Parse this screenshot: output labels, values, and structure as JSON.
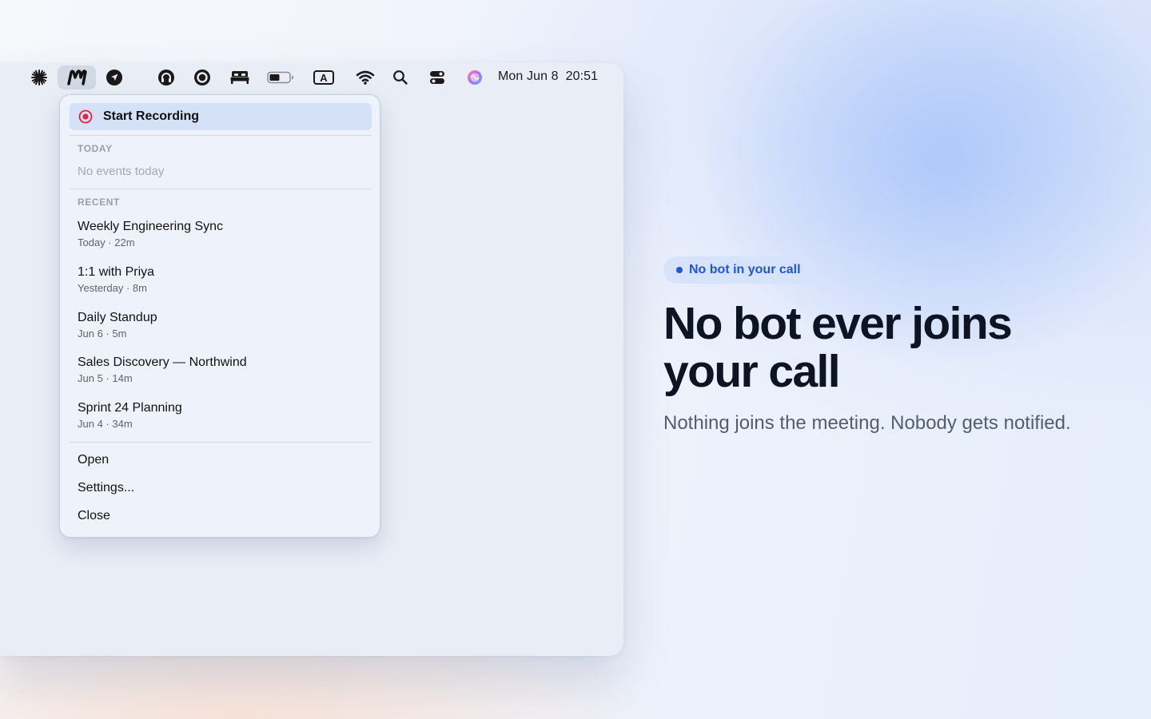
{
  "menubar": {
    "icons": [
      "asterisk-icon",
      "app-logo-icon",
      "navigation-arrow-icon",
      "headphones-icon",
      "record-circle-icon",
      "bed-icon",
      "battery-icon",
      "input-source-icon",
      "wifi-icon",
      "spotlight-search-icon",
      "control-center-icon",
      "siri-icon"
    ],
    "input_source_label": "A",
    "date": "Mon Jun 8",
    "time": "20:51"
  },
  "dropdown": {
    "primary_action": "Start Recording",
    "today_header": "TODAY",
    "today_empty": "No events today",
    "recent_header": "RECENT",
    "recent": [
      {
        "title": "Weekly Engineering Sync",
        "meta": "Today · 22m"
      },
      {
        "title": "1:1 with Priya",
        "meta": "Yesterday · 8m"
      },
      {
        "title": "Daily Standup",
        "meta": "Jun 6 · 5m"
      },
      {
        "title": "Sales Discovery — Northwind",
        "meta": "Jun 5 · 14m"
      },
      {
        "title": "Sprint 24 Planning",
        "meta": "Jun 4 · 34m"
      }
    ],
    "actions": [
      "Open",
      "Settings...",
      "Close"
    ]
  },
  "hero": {
    "badge": "No bot in your call",
    "headline": "No bot ever joins your call",
    "subhead": "Nothing joins the meeting. Nobody gets notified."
  },
  "colors": {
    "accent": "#1f55d6",
    "record": "#e0243a",
    "headline": "#0d1424"
  }
}
